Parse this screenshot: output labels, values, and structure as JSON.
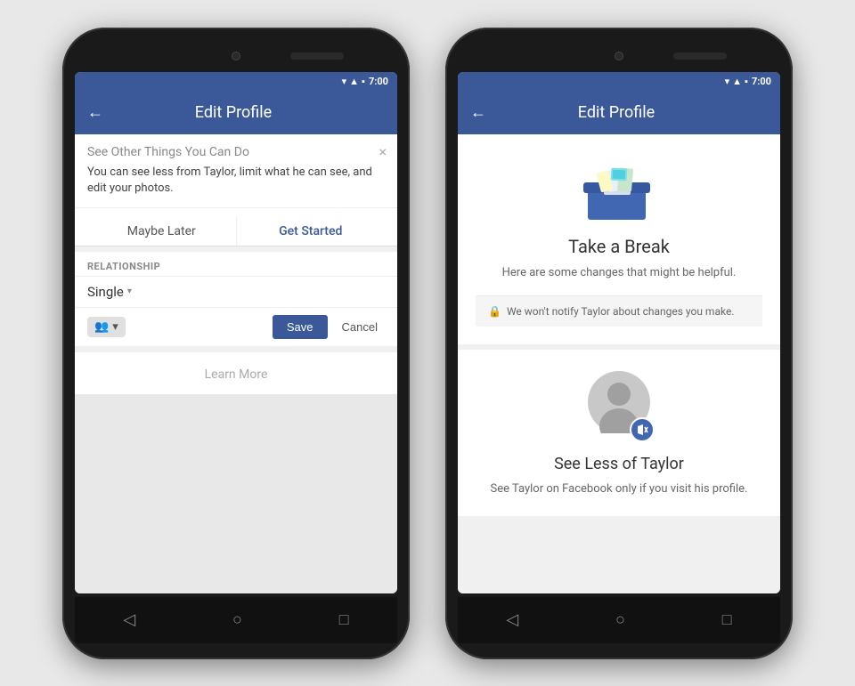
{
  "phone1": {
    "status_bar": {
      "time": "7:00"
    },
    "app_bar": {
      "title": "Edit Profile",
      "back_label": "←"
    },
    "banner": {
      "title": "See Other Things You Can Do",
      "text": "You can see less from Taylor, limit what he can see, and edit your photos.",
      "maybe_later": "Maybe Later",
      "get_started": "Get Started",
      "close": "×"
    },
    "relationship": {
      "label": "RELATIONSHIP",
      "value": "Single",
      "save_btn": "Save",
      "cancel_btn": "Cancel"
    },
    "learn_more": "Learn More",
    "nav": {
      "back": "◁",
      "home": "○",
      "recent": "□"
    }
  },
  "phone2": {
    "status_bar": {
      "time": "7:00"
    },
    "app_bar": {
      "title": "Edit Profile",
      "back_label": "←"
    },
    "take_break": {
      "title": "Take a Break",
      "subtitle": "Here are some changes that\nmight be helpful.",
      "privacy_note": "We won't notify Taylor about changes you make."
    },
    "see_less": {
      "title": "See Less of Taylor",
      "subtitle": "See Taylor on Facebook only\nif you visit his profile."
    },
    "nav": {
      "back": "◁",
      "home": "○",
      "recent": "□"
    }
  }
}
